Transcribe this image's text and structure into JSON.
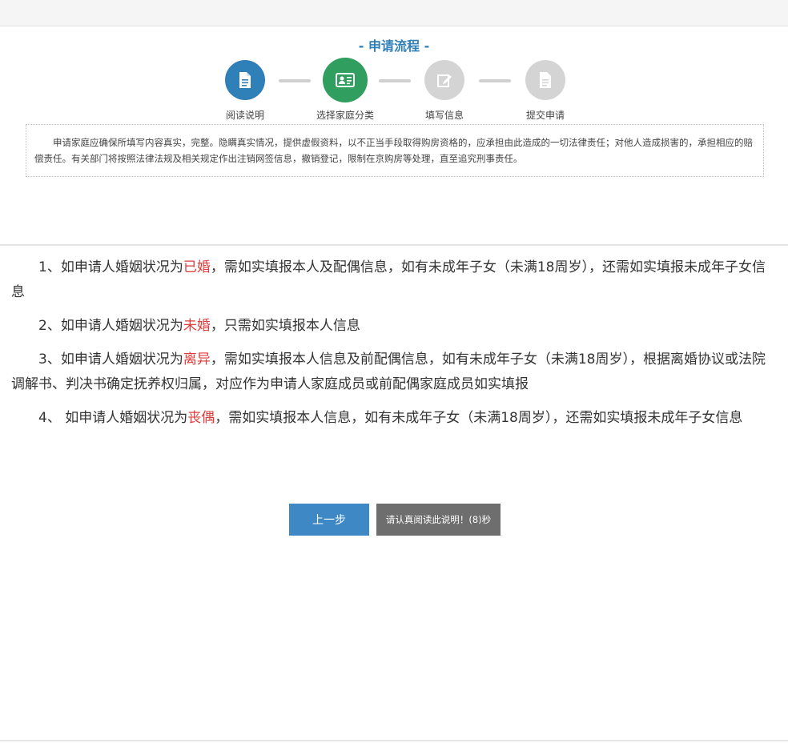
{
  "flow": {
    "title": "- 申请流程 -",
    "steps": [
      {
        "label": "阅读说明",
        "icon": "document-icon",
        "status": "done",
        "color": "#2f7fb8"
      },
      {
        "label": "选择家庭分类",
        "icon": "id-card-icon",
        "status": "current",
        "color": "#2f9e5e"
      },
      {
        "label": "填写信息",
        "icon": "edit-icon",
        "status": "pending",
        "color": "#d4d4d4"
      },
      {
        "label": "提交申请",
        "icon": "file-icon",
        "status": "pending",
        "color": "#d4d4d4"
      }
    ]
  },
  "notice": {
    "text": "申请家庭应确保所填写内容真实，完整。隐瞒真实情况，提供虚假资料，以不正当手段取得购房资格的，应承担由此造成的一切法律责任；对他人造成损害的，承担相应的赔偿责任。有关部门将按照法律法规及相关规定作出注销网签信息，撤销登记，限制在京购房等处理，直至追究刑事责任。"
  },
  "instructions": [
    {
      "before": "1、如申请人婚姻状况为",
      "highlight": "已婚",
      "after": "，需如实填报本人及配偶信息，如有未成年子女（未满18周岁），还需如实填报未成年子女信息"
    },
    {
      "before": "2、如申请人婚姻状况为",
      "highlight": "未婚",
      "after": "，只需如实填报本人信息"
    },
    {
      "before": "3、如申请人婚姻状况为",
      "highlight": "离异",
      "after": "，需如实填报本人信息及前配偶信息，如有未成年子女（未满18周岁），根据离婚协议或法院调解书、判决书确定抚养权归属，对应作为申请人家庭成员或前配偶家庭成员如实填报"
    },
    {
      "before": "4、 如申请人婚姻状况为",
      "highlight": "丧偶",
      "after": "，需如实填报本人信息，如有未成年子女（未满18周岁），还需如实填报未成年子女信息"
    }
  ],
  "buttons": {
    "prev": "上一步",
    "wait": "请认真阅读此说明！(8)秒"
  },
  "colors": {
    "accent": "#2f7fb8",
    "step_current": "#2f9e5e",
    "highlight": "#e03b3b",
    "button_disabled": "#6e6e6e"
  }
}
